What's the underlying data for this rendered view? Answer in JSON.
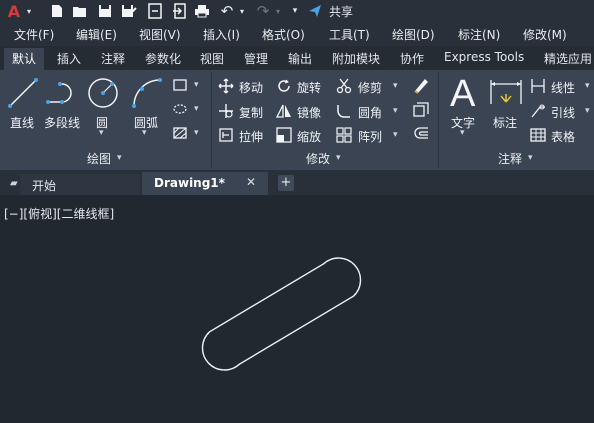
{
  "app": {
    "logo": "A",
    "share_label": "共享"
  },
  "quick_access": {
    "icons": [
      "new-icon",
      "open-icon",
      "save-icon",
      "save-as-icon",
      "open-from-web-icon",
      "export-icon",
      "print-icon",
      "undo-icon",
      "redo-icon",
      "customize-icon"
    ]
  },
  "menu": {
    "items": [
      "文件(F)",
      "编辑(E)",
      "视图(V)",
      "插入(I)",
      "格式(O)",
      "工具(T)",
      "绘图(D)",
      "标注(N)",
      "修改(M)"
    ]
  },
  "ribbon_tabs": [
    "默认",
    "插入",
    "注释",
    "参数化",
    "视图",
    "管理",
    "输出",
    "附加模块",
    "协作",
    "Express Tools",
    "精选应用"
  ],
  "active_tab": "默认",
  "draw_panel": {
    "title": "绘图",
    "line": "直线",
    "polyline": "多段线",
    "circle": "圆",
    "arc": "圆弧"
  },
  "modify_panel": {
    "title": "修改",
    "move": "移动",
    "rotate": "旋转",
    "trim": "修剪",
    "copy": "复制",
    "mirror": "镜像",
    "fillet": "圆角",
    "stretch": "拉伸",
    "scale": "缩放",
    "array": "阵列"
  },
  "annotation_panel": {
    "title": "注释",
    "text": "文字",
    "dimension": "标注",
    "linear": "线性",
    "leader": "引线",
    "table": "表格"
  },
  "doc_tabs": {
    "start": "开始",
    "current": "Drawing1*",
    "close": "✕",
    "add": "+"
  },
  "viewport": {
    "label": "[−][俯视][二维线框]"
  },
  "colors": {
    "accent": "#d63a3a",
    "ribbon": "#3b4453",
    "canvas": "#212830",
    "active_tab": "#3b4453"
  }
}
